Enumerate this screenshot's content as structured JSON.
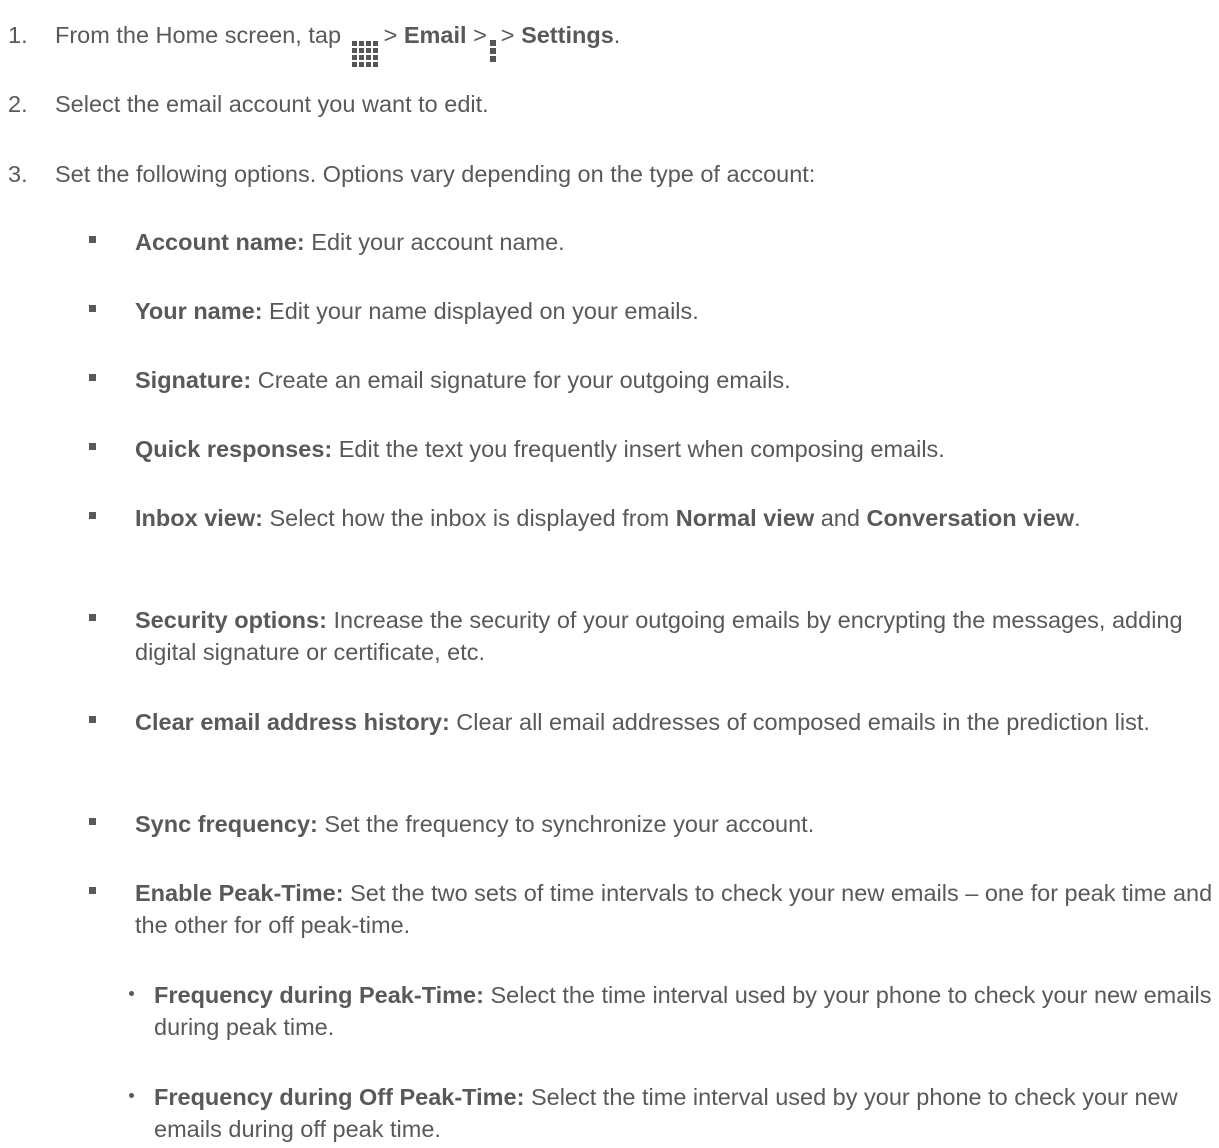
{
  "steps": [
    {
      "number": "1.",
      "pre": "From the Home screen, tap",
      "sep1": ">",
      "email": "Email",
      "sep2": ">",
      "sep3": ">",
      "settings": "Settings",
      "end": ".",
      "apps_icon": "apps-grid-icon",
      "menu_icon": "menu-vertical-icon"
    },
    {
      "number": "2.",
      "text": "Select the email account you want to edit."
    },
    {
      "number": "3.",
      "text": "Set the following options. Options vary depending on the type of account:"
    }
  ],
  "options": [
    {
      "term": "Account name:",
      "desc": " Edit your account name."
    },
    {
      "term": "Your name:",
      "desc": " Edit your name displayed on your emails."
    },
    {
      "term": "Signature:",
      "desc": " Create an email signature for your outgoing emails."
    },
    {
      "term": "Quick responses:",
      "desc": " Edit the text you frequently insert when composing emails."
    },
    {
      "term": "Inbox view:",
      "desc": " Select how the inbox is displayed from ",
      "b1": "Normal view",
      "mid": " and ",
      "b2": "Conversation view",
      "end": "."
    },
    {
      "term": "Security options:",
      "desc": " Increase the security of your outgoing emails by encrypting the messages, adding digital signature or certificate, etc."
    },
    {
      "term": "Clear email address history:",
      "desc": " Clear all email addresses of composed emails in the prediction list."
    },
    {
      "term": "Sync frequency:",
      "desc": " Set the frequency to synchronize your account."
    },
    {
      "term": "Enable Peak-Time:",
      "desc": " Set the two sets of time intervals to check your new emails – one for peak time and the other for off peak-time."
    }
  ],
  "suboptions": [
    {
      "term": "Frequency during Peak-Time:",
      "desc": " Select the time interval used by your phone to check your new emails during peak time."
    },
    {
      "term": "Frequency during Off Peak-Time:",
      "desc": " Select the time interval used by your phone to check your new emails during off peak time."
    }
  ]
}
